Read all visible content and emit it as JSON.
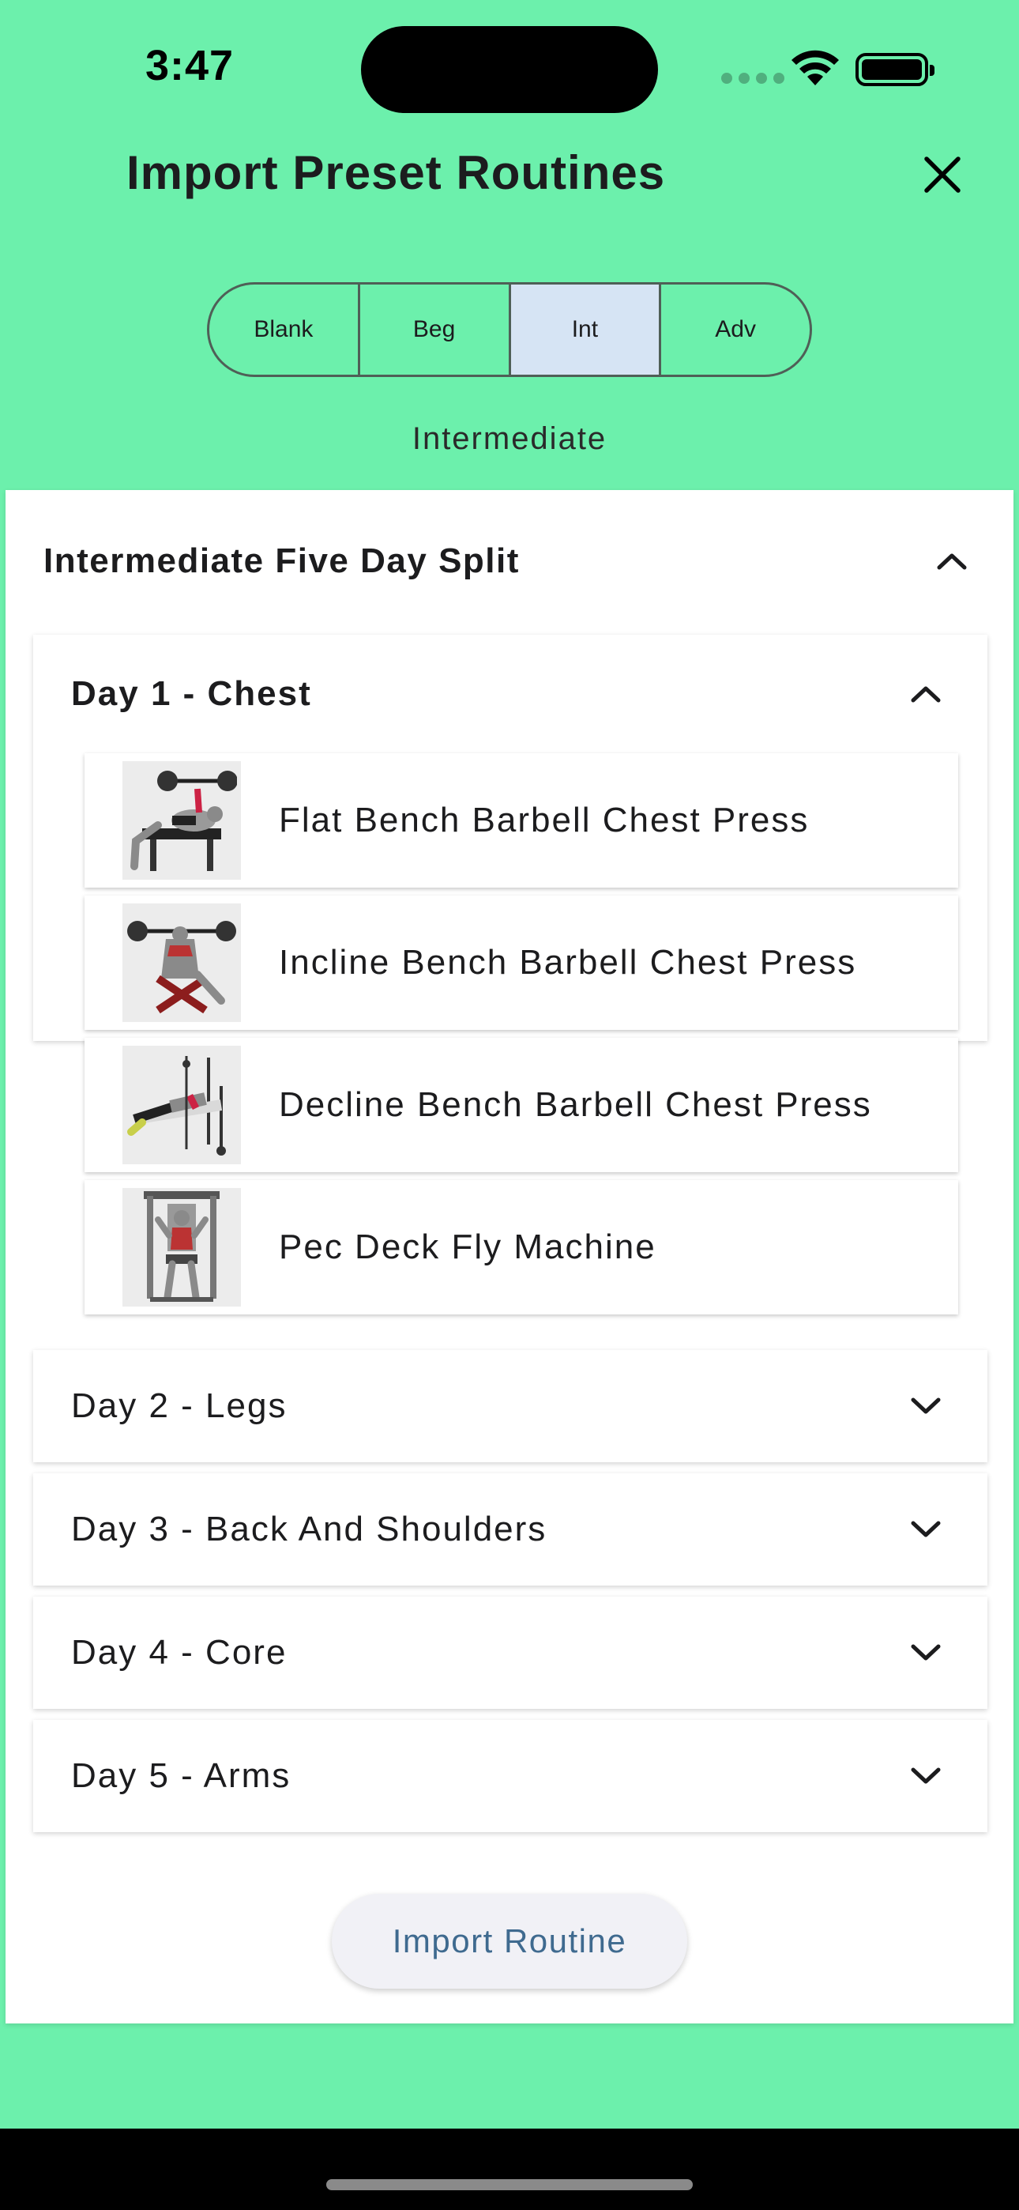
{
  "status_bar": {
    "time": "3:47"
  },
  "header": {
    "title": "Import Preset Routines",
    "close_icon": "close-icon"
  },
  "segments": [
    {
      "label": "Blank",
      "selected": false
    },
    {
      "label": "Beg",
      "selected": false
    },
    {
      "label": "Int",
      "selected": true
    },
    {
      "label": "Adv",
      "selected": false
    }
  ],
  "level_label": "Intermediate",
  "routine": {
    "title": "Intermediate Five Day Split",
    "expanded": true,
    "days": [
      {
        "title": "Day 1 - Chest",
        "expanded": true,
        "exercises": [
          {
            "name": "Flat Bench Barbell Chest Press",
            "icon": "flat-bench-press-image"
          },
          {
            "name": "Incline Bench Barbell Chest Press",
            "icon": "incline-bench-press-image"
          },
          {
            "name": "Decline Bench Barbell Chest Press",
            "icon": "decline-bench-press-image"
          },
          {
            "name": "Pec Deck Fly Machine",
            "icon": "pec-deck-machine-image"
          }
        ]
      },
      {
        "title": "Day 2 - Legs",
        "expanded": false
      },
      {
        "title": "Day 3 - Back And Shoulders",
        "expanded": false
      },
      {
        "title": "Day 4 - Core",
        "expanded": false
      },
      {
        "title": "Day 5 - Arms",
        "expanded": false
      }
    ]
  },
  "import_button": {
    "label": "Import Routine"
  },
  "colors": {
    "background": "#6cf0ac",
    "segment_selected": "#d6e4f4",
    "button_text": "#3f6a8f"
  }
}
